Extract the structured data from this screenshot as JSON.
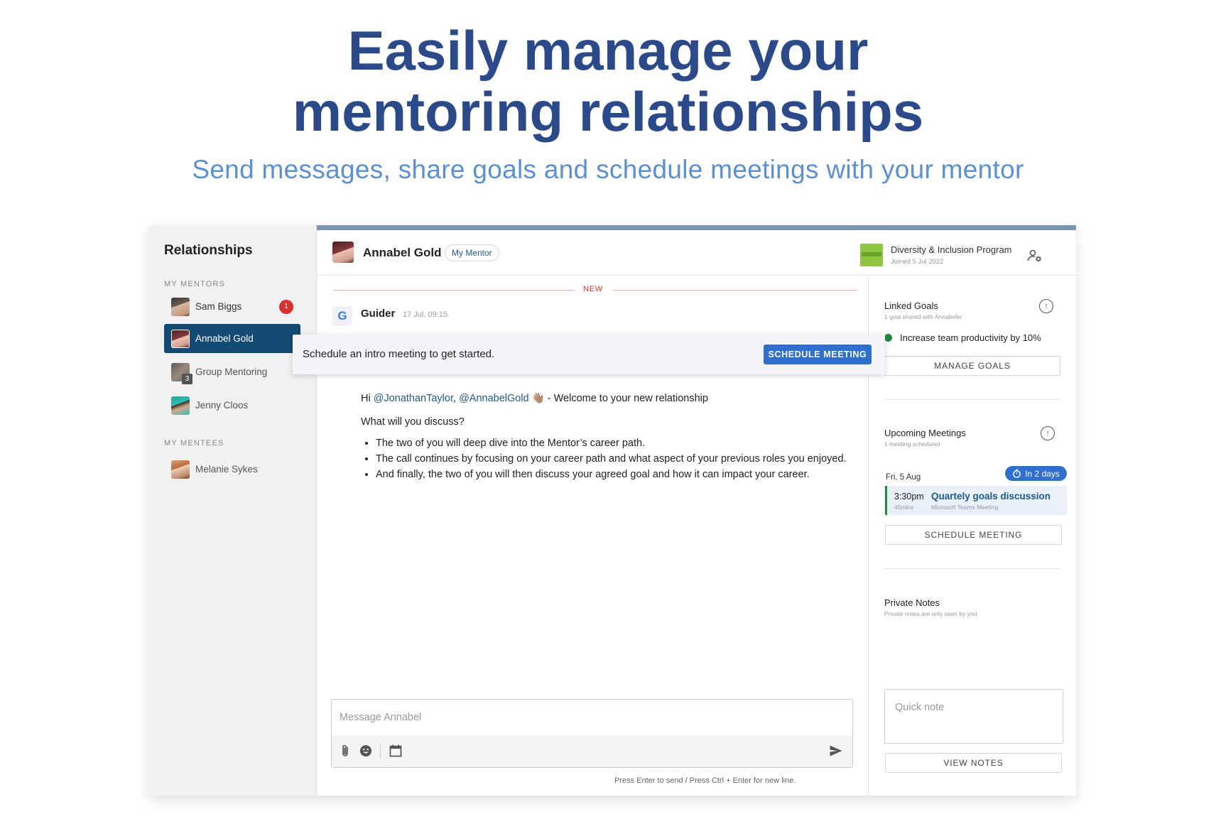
{
  "hero": {
    "title_line1": "Easily manage your",
    "title_line2": "mentoring relationships",
    "subtitle": "Send messages, share goals and schedule meetings with your mentor"
  },
  "sidebar": {
    "title": "Relationships",
    "mentors_label": "MY MENTORS",
    "mentees_label": "MY MENTEES",
    "mentors": [
      {
        "name": "Sam Biggs",
        "badge": "1",
        "avatar": "person-avatar",
        "active": false
      },
      {
        "name": "Annabel Gold",
        "avatar": "person-avatar",
        "active": true
      },
      {
        "name": "Group Mentoring",
        "group_count": "3",
        "avatar": "group-avatar",
        "active": false
      },
      {
        "name": "Jenny Cloos",
        "avatar": "person-avatar",
        "active": false
      }
    ],
    "mentees": [
      {
        "name": "Melanie Sykes",
        "avatar": "person-avatar"
      }
    ]
  },
  "chat_header": {
    "name": "Annabel Gold",
    "tag": "My Mentor",
    "program_name": "Diversity & Inclusion Program",
    "program_joined": "Joined 5 Jul 2022",
    "settings_icon": "user-settings-icon"
  },
  "chat": {
    "new_label": "NEW",
    "author": "Guider",
    "author_icon": "G",
    "time": "17 Jul, 09:15",
    "banner_text": "Schedule an intro meeting to get started.",
    "banner_button": "SCHEDULE MEETING",
    "greeting_prefix": "Hi ",
    "mention1": "@JonathanTaylor",
    "comma": ", ",
    "mention2": "@AnnabelGold",
    "emoji": "👋🏽",
    "greeting_suffix": " - Welcome to your new relationship",
    "question": "What will you discuss?",
    "bullets": [
      "The two of you will deep dive into the Mentor’s career path.",
      "The call continues by focusing on your career path and what aspect of your previous roles you enjoyed.",
      "And finally, the two of you will then discuss your agreed goal and how it can impact your career."
    ]
  },
  "composer": {
    "placeholder": "Message Annabel",
    "value": "",
    "icons": [
      "attachment-icon",
      "emoji-icon",
      "calendar-icon",
      "send-icon"
    ],
    "hint": "Press Enter to send / Press Ctrl + Enter for new line."
  },
  "right_panel": {
    "goals_title": "Linked Goals",
    "goals_sub": "1 goal shared with Annabelle",
    "goal_item": "Increase team productivity by 10%",
    "manage_goals": "MANAGE GOALS",
    "meetings_title": "Upcoming Meetings",
    "meetings_sub": "1 meeting scheduled",
    "meeting_date": "Fri, 5 Aug",
    "meeting_pill": "In 2 days",
    "meeting_time": "3:30pm",
    "meeting_duration": "45mins",
    "meeting_title": "Quartely goals discussion",
    "meeting_location": "Microsoft Teams Meeting",
    "schedule_meeting": "SCHEDULE MEETING",
    "notes_title": "Private Notes",
    "notes_sub": "Private notes are only seen by you",
    "notes_placeholder": "Quick note",
    "view_notes": "VIEW NOTES"
  },
  "colors": {
    "hero_title": "#2a4a8c",
    "hero_subtitle": "#5b8fd6",
    "active_item": "#134a73",
    "accent_button": "#2f6fd0",
    "badge": "#d8312c",
    "goal_dot": "#1e8a3a"
  }
}
